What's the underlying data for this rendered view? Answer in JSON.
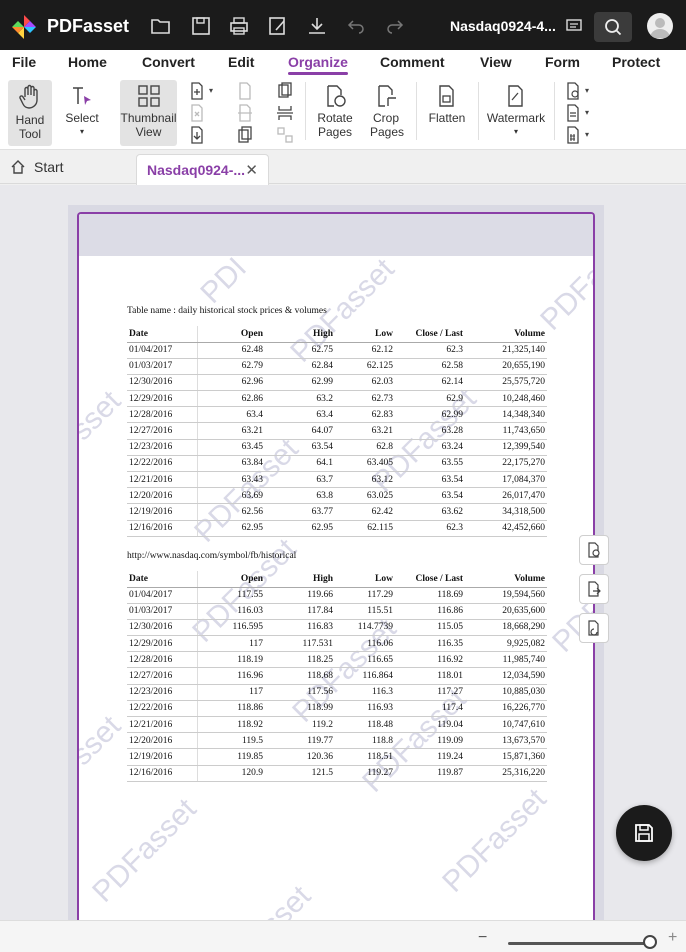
{
  "app": {
    "name": "PDFasset",
    "doc_title": "Nasdaq0924-4..."
  },
  "menu": [
    "File",
    "Home",
    "Convert",
    "Edit",
    "Organize",
    "Comment",
    "View",
    "Form",
    "Protect"
  ],
  "menu_active": "Organize",
  "ribbon": {
    "hand_tool": "Hand Tool",
    "select": "Select",
    "thumbnail_view": "Thumbnail View",
    "rotate_pages": "Rotate Pages",
    "crop_pages": "Crop Pages",
    "flatten": "Flatten",
    "watermark": "Watermark"
  },
  "tabs": {
    "start": "Start",
    "doc": "Nasdaq0924-..."
  },
  "document": {
    "table_name": "Table name : daily historical stock prices & volumes",
    "headers": [
      "Date",
      "Open",
      "High",
      "Low",
      "Close / Last",
      "Volume"
    ],
    "table1": [
      [
        "01/04/2017",
        "62.48",
        "62.75",
        "62.12",
        "62.3",
        "21,325,140"
      ],
      [
        "01/03/2017",
        "62.79",
        "62.84",
        "62.125",
        "62.58",
        "20,655,190"
      ],
      [
        "12/30/2016",
        "62.96",
        "62.99",
        "62.03",
        "62.14",
        "25,575,720"
      ],
      [
        "12/29/2016",
        "62.86",
        "63.2",
        "62.73",
        "62.9",
        "10,248,460"
      ],
      [
        "12/28/2016",
        "63.4",
        "63.4",
        "62.83",
        "62.99",
        "14,348,340"
      ],
      [
        "12/27/2016",
        "63.21",
        "64.07",
        "63.21",
        "63.28",
        "11,743,650"
      ],
      [
        "12/23/2016",
        "63.45",
        "63.54",
        "62.8",
        "63.24",
        "12,399,540"
      ],
      [
        "12/22/2016",
        "63.84",
        "64.1",
        "63.405",
        "63.55",
        "22,175,270"
      ],
      [
        "12/21/2016",
        "63.43",
        "63.7",
        "63.12",
        "63.54",
        "17,084,370"
      ],
      [
        "12/20/2016",
        "63.69",
        "63.8",
        "63.025",
        "63.54",
        "26,017,470"
      ],
      [
        "12/19/2016",
        "62.56",
        "63.77",
        "62.42",
        "63.62",
        "34,318,500"
      ],
      [
        "12/16/2016",
        "62.95",
        "62.95",
        "62.115",
        "62.3",
        "42,452,660"
      ]
    ],
    "url": "http://www.nasdaq.com/symbol/fb/historical",
    "table2": [
      [
        "01/04/2017",
        "117.55",
        "119.66",
        "117.29",
        "118.69",
        "19,594,560"
      ],
      [
        "01/03/2017",
        "116.03",
        "117.84",
        "115.51",
        "116.86",
        "20,635,600"
      ],
      [
        "12/30/2016",
        "116.595",
        "116.83",
        "114.7739",
        "115.05",
        "18,668,290"
      ],
      [
        "12/29/2016",
        "117",
        "117.531",
        "116.06",
        "116.35",
        "9,925,082"
      ],
      [
        "12/28/2016",
        "118.19",
        "118.25",
        "116.65",
        "116.92",
        "11,985,740"
      ],
      [
        "12/27/2016",
        "116.96",
        "118.68",
        "116.864",
        "118.01",
        "12,034,590"
      ],
      [
        "12/23/2016",
        "117",
        "117.56",
        "116.3",
        "117.27",
        "10,885,030"
      ],
      [
        "12/22/2016",
        "118.86",
        "118.99",
        "116.93",
        "117.4",
        "16,226,770"
      ],
      [
        "12/21/2016",
        "118.92",
        "119.2",
        "118.48",
        "119.04",
        "10,747,610"
      ],
      [
        "12/20/2016",
        "119.5",
        "119.77",
        "118.8",
        "119.09",
        "13,673,570"
      ],
      [
        "12/19/2016",
        "119.85",
        "120.36",
        "118.51",
        "119.24",
        "15,871,360"
      ],
      [
        "12/16/2016",
        "120.9",
        "121.5",
        "119.27",
        "119.87",
        "25,316,220"
      ]
    ],
    "watermark_text": "PDFasset",
    "watermark_fragment_1": "PDI",
    "watermark_fragment_2": "sset"
  },
  "colors": {
    "accent": "#8a3fa7",
    "titlebar": "#1b1b1b"
  }
}
